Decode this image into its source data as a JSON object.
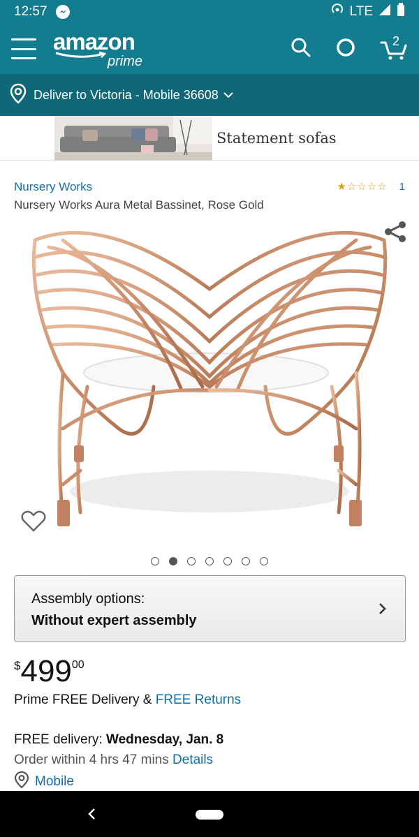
{
  "status_bar": {
    "time": "12:57",
    "network": "LTE"
  },
  "header": {
    "logo_text": "amazon",
    "logo_sub": "prime",
    "cart_count": "2"
  },
  "deliver": {
    "text": "Deliver to Victoria - Mobile 36608"
  },
  "banner": {
    "text": "Statement sofas"
  },
  "product": {
    "brand": "Nursery Works",
    "title": "Nursery Works Aura Metal Bassinet, Rose Gold",
    "rating_count": "1",
    "rating": 1,
    "rating_max": 5,
    "image_count": 7,
    "active_image": 2
  },
  "assembly": {
    "label": "Assembly options:",
    "value": "Without expert assembly"
  },
  "price": {
    "symbol": "$",
    "whole": "499",
    "fraction": "00"
  },
  "delivery": {
    "prefix": "Prime FREE Delivery & ",
    "returns_link": "FREE Returns",
    "free_label": "FREE delivery: ",
    "free_date": "Wednesday, Jan. 8",
    "order_within": "Order within 4 hrs 47 mins ",
    "details_link": "Details",
    "location": "Mobile"
  },
  "colors": {
    "header_bg": "#137d8f",
    "deliver_bg": "#0f6777",
    "link": "#0f6ea8",
    "star": "#e79a11"
  }
}
